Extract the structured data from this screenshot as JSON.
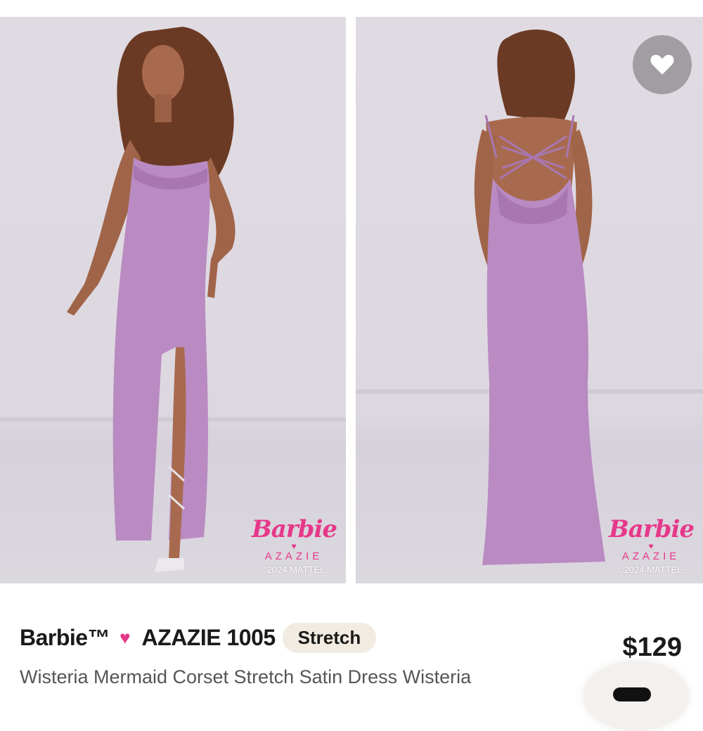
{
  "gallery": {
    "front_alt": "front view",
    "back_alt": "back view",
    "watermark": {
      "barbie": "Barbie",
      "azazie": "AZAZIE",
      "copyright": "©2024 MATTEL."
    },
    "favorite_icon": "heart-icon"
  },
  "product": {
    "brand": "Barbie™",
    "brand_heart": "♥",
    "collection": "AZAZIE 1005",
    "badge": "Stretch",
    "price": "$129",
    "name": "Wisteria Mermaid Corset Stretch Satin Dress Wisteria"
  },
  "colors": {
    "dress": "#b98bc2",
    "accent": "#e6388a",
    "background": "#dedae2",
    "badge": "#f1ebe1"
  },
  "chat": {
    "icon": "chat-icon"
  }
}
